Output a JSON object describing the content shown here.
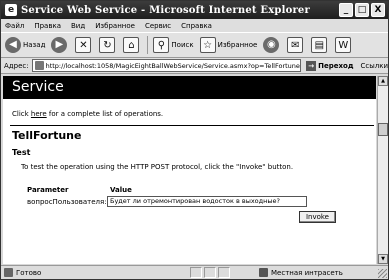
{
  "window": {
    "title": "Service Web Service - Microsoft Internet Explorer",
    "icon_letter": "e",
    "controls": [
      "_",
      "□",
      "X"
    ]
  },
  "menu": [
    "Файл",
    "Правка",
    "Вид",
    "Избранное",
    "Сервис",
    "Справка"
  ],
  "toolbar": {
    "back_label": "Назад",
    "back_icon": "back-arrow-icon",
    "forward_icon": "forward-arrow-icon",
    "stop_icon": "stop-icon",
    "refresh_icon": "refresh-icon",
    "home_icon": "home-icon",
    "search_label": "Поиск",
    "favorites_label": "Избранное",
    "media_icon": "media-icon",
    "history_icon": "history-icon",
    "mail_icon": "mail-icon",
    "print_icon": "print-icon",
    "edit_icon": "edit-icon"
  },
  "address": {
    "label": "Адрес:",
    "url": "http://localhost:1058/MagicEightBallWebService/Service.asmx?op=TellFortune",
    "go_label": "Переход",
    "links_label": "Ссылки"
  },
  "page": {
    "banner": "Service",
    "intro_prefix": "Click ",
    "intro_link": "here",
    "intro_suffix": " for a complete list of operations.",
    "operation_title": "TellFortune",
    "section_title": "Test",
    "instructions": "To test the operation using the HTTP POST protocol, click the \"Invoke\" button.",
    "param_header": "Parameter",
    "value_header": "Value",
    "param_name": "вопросПользователя:",
    "param_value": "Будет ли отремонтирован водосток в выходные?",
    "invoke_label": "Invoke"
  },
  "status": {
    "text": "Готово",
    "zone": "Местная интрасеть"
  }
}
